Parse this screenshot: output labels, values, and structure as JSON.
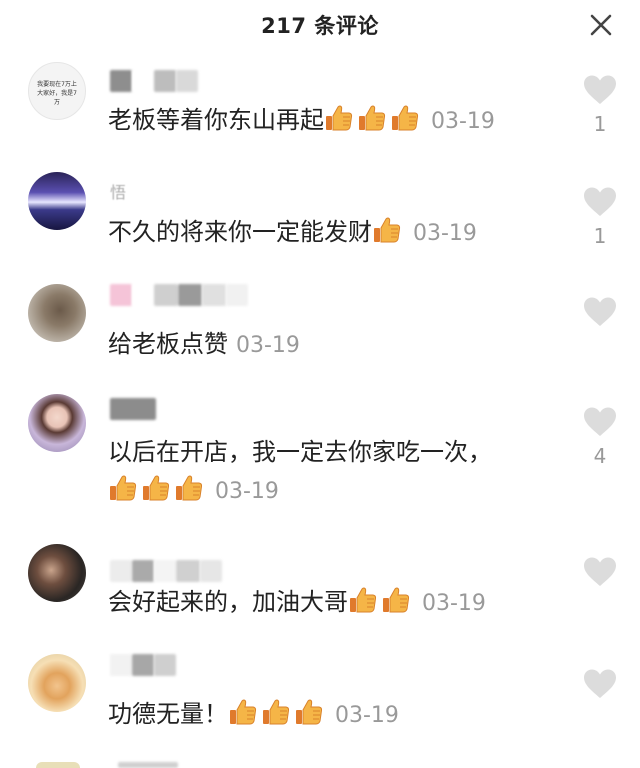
{
  "header": {
    "title": "217 条评论",
    "close_icon": "close-icon"
  },
  "colors": {
    "text": "#222222",
    "meta": "#999999",
    "heart": "#dddddd"
  },
  "comments": [
    {
      "username": "",
      "text": "老板等着你东山再起",
      "thumbs": 3,
      "date": "03-19",
      "likes": "1",
      "avatar_text": "我要现在7万上 大家好，我是7万"
    },
    {
      "username": "悟",
      "text": "不久的将来你一定能发财",
      "thumbs": 1,
      "date": "03-19",
      "likes": "1"
    },
    {
      "username": "",
      "text": "给老板点赞",
      "thumbs": 0,
      "date": "03-19",
      "likes": ""
    },
    {
      "username": "",
      "text": "以后在开店，我一定去你家吃一次，",
      "thumbs": 3,
      "date": "03-19",
      "likes": "4"
    },
    {
      "username": "",
      "text": "会好起来的，加油大哥",
      "thumbs": 2,
      "date": "03-19",
      "likes": ""
    },
    {
      "username": "",
      "text": "功德无量！",
      "thumbs": 3,
      "date": "03-19",
      "likes": ""
    }
  ]
}
